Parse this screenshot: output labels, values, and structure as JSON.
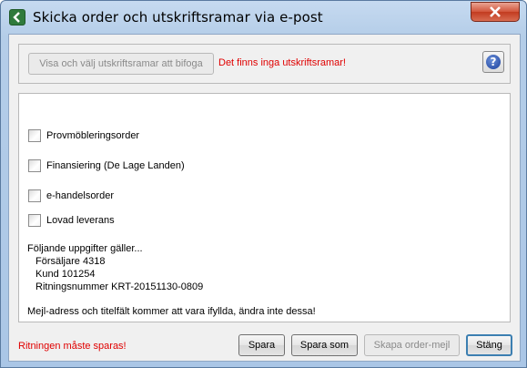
{
  "window": {
    "title": "Skicka order och utskriftsramar via e-post"
  },
  "top_panel": {
    "attach_button_label": "Visa och välj utskriftsramar att bifoga",
    "warning_text": "Det finns inga utskriftsramar!",
    "help_icon": "help-icon",
    "help_glyph": "?"
  },
  "options": [
    {
      "label": "Provmöbleringsorder",
      "checked": false
    },
    {
      "label": "Finansiering (De Lage Landen)",
      "checked": false
    },
    {
      "label": "e-handelsorder",
      "checked": false
    },
    {
      "label": "Lovad leverans",
      "checked": false
    }
  ],
  "info": {
    "heading": "Följande uppgifter gäller...",
    "seller": "Försäljare 4318",
    "customer": "Kund 101254",
    "drawing_number": "Ritningsnummer KRT-20151130-0809",
    "note": "Mejl-adress och titelfält kommer att vara ifyllda, ändra inte dessa!"
  },
  "footer": {
    "warning_text": "Ritningen måste sparas!",
    "save_label": "Spara",
    "save_as_label": "Spara som",
    "create_mail_label": "Skapa order-mejl",
    "close_label": "Stäng"
  },
  "colors": {
    "warning": "#e00000",
    "close_button": "#c23b1f"
  }
}
